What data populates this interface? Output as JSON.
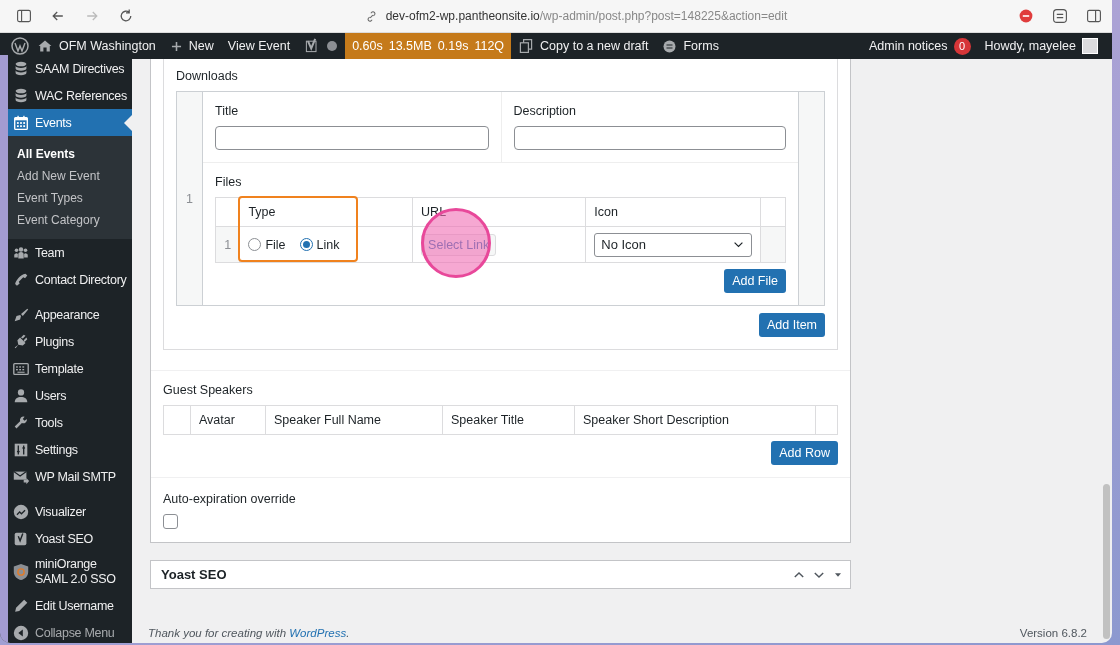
{
  "browser": {
    "url_host": "dev-ofm2-wp.pantheonsite.io",
    "url_path": "/wp-admin/post.php?post=148225&action=edit"
  },
  "admin_bar": {
    "site": "OFM Washington",
    "new": "New",
    "view": "View Event",
    "perf": [
      "0.60s",
      "13.5MB",
      "0.19s",
      "112Q"
    ],
    "copy": "Copy to a new draft",
    "forms": "Forms",
    "notices": "Admin notices",
    "notices_count": "0",
    "howdy": "Howdy, mayelee"
  },
  "sidebar": {
    "groups": [
      [
        {
          "label": "SAAM Directives",
          "selected": false
        },
        {
          "label": "WAC References",
          "selected": false
        },
        {
          "label": "Events",
          "selected": true,
          "children": [
            {
              "label": "All Events",
              "selected": true
            },
            {
              "label": "Add New Event",
              "selected": false
            },
            {
              "label": "Event Types",
              "selected": false
            },
            {
              "label": "Event Category",
              "selected": false
            }
          ]
        },
        {
          "label": "Team",
          "selected": false
        },
        {
          "label": "Contact Directory",
          "selected": false
        }
      ],
      [
        {
          "label": "Appearance",
          "selected": false
        },
        {
          "label": "Plugins",
          "selected": false
        },
        {
          "label": "Template",
          "selected": false
        },
        {
          "label": "Users",
          "selected": false
        },
        {
          "label": "Tools",
          "selected": false
        },
        {
          "label": "Settings",
          "selected": false
        },
        {
          "label": "WP Mail SMTP",
          "selected": false
        }
      ],
      [
        {
          "label": "Visualizer",
          "selected": false
        },
        {
          "label": "Yoast SEO",
          "selected": false
        },
        {
          "label": "miniOrange SAML 2.0 SSO",
          "selected": false
        },
        {
          "label": "Edit Username",
          "selected": false
        }
      ]
    ],
    "collapse": "Collapse Menu"
  },
  "downloads": {
    "label": "Downloads",
    "row_number": "1",
    "title_label": "Title",
    "description_label": "Description",
    "files_label": "Files",
    "files_columns": [
      "Type",
      "URL",
      "Icon"
    ],
    "files_rows": [
      {
        "number": "1",
        "types": [
          {
            "label": "File",
            "selected": false
          },
          {
            "label": "Link",
            "selected": true
          }
        ],
        "url_button": "Select Link",
        "icon_select": "No Icon"
      }
    ],
    "add_file": "Add File",
    "add_item": "Add Item"
  },
  "guest_speakers": {
    "label": "Guest Speakers",
    "columns": [
      "Avatar",
      "Speaker Full Name",
      "Speaker Title",
      "Speaker Short Description"
    ],
    "add_row": "Add Row"
  },
  "auto_expiration": {
    "label": "Auto-expiration override",
    "checked": false
  },
  "yoast_panel": {
    "title": "Yoast SEO"
  },
  "footer": {
    "text": "Thank you for creating with ",
    "link": "WordPress",
    "after": ".",
    "version": "Version 6.8.2"
  }
}
